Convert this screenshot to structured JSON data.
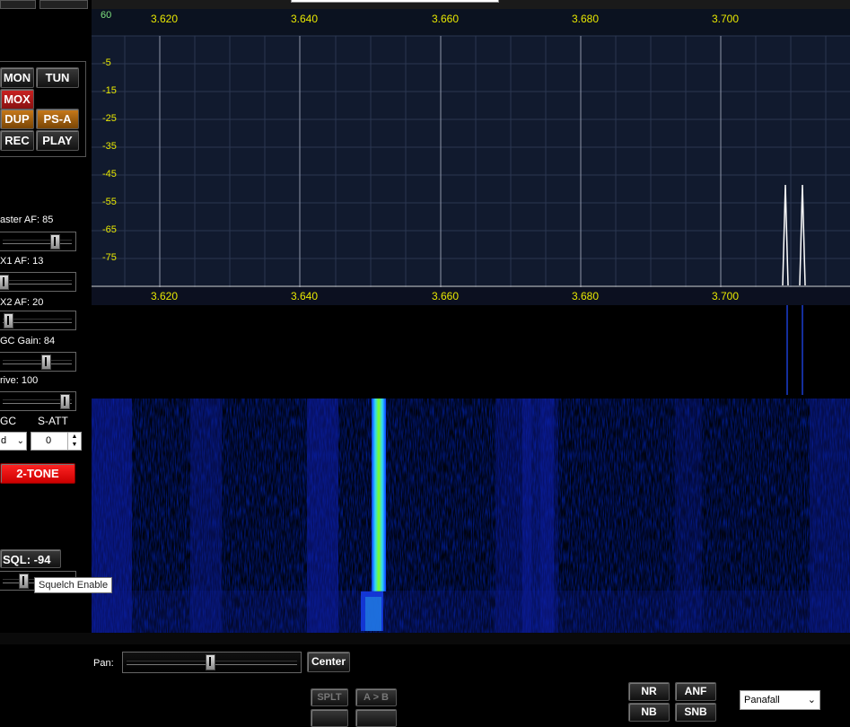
{
  "panadapter": {
    "top_scale_label": "60",
    "freq_labels": [
      "3.620",
      "3.640",
      "3.660",
      "3.680",
      "3.700"
    ],
    "db_labels": [
      "-5",
      "-15",
      "-25",
      "-35",
      "-45",
      "-55",
      "-65",
      "-75"
    ]
  },
  "buttons": {
    "mon": "MON",
    "tun": "TUN",
    "mox": "MOX",
    "dup": "DUP",
    "psa": "PS-A",
    "rec": "REC",
    "play": "PLAY",
    "two_tone": "2-TONE",
    "sql": "SQL: -94",
    "center": "Center",
    "splt": "SPLT",
    "a_to_b": "A > B",
    "nr": "NR",
    "anf": "ANF",
    "nb": "NB",
    "snb": "SNB"
  },
  "sliders": {
    "master_af": {
      "label": "aster AF:",
      "value": "85"
    },
    "rx1_af": {
      "label": "X1 AF:",
      "value": "13"
    },
    "rx2_af": {
      "label": "X2 AF:",
      "value": "20"
    },
    "agc_gain": {
      "label": "GC Gain:",
      "value": "84"
    },
    "drive": {
      "label": "rive:",
      "value": "100"
    }
  },
  "agc": {
    "agc_label": "GC",
    "satt_label": "S-ATT",
    "agc_value": "d",
    "satt_value": "0"
  },
  "tooltip": "Squelch Enable",
  "pan_label": "Pan:",
  "display_mode": "Panafall",
  "colors": {
    "pan_bg": "#111a2e",
    "freq_label": "#e8e800",
    "db_label": "#e8e800",
    "top_label": "#7ee07e",
    "signal": "#7cff20"
  }
}
